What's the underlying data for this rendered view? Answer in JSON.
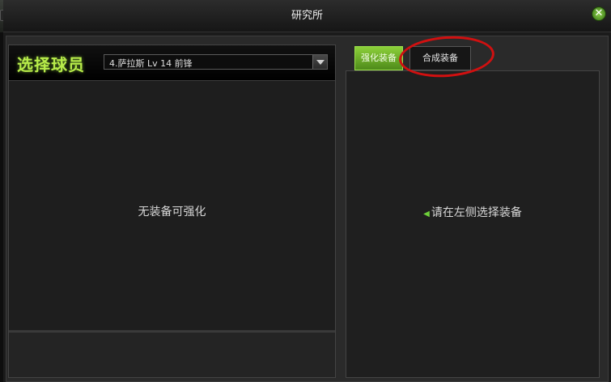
{
  "window": {
    "title": "研究所",
    "close_icon": "close-icon"
  },
  "left_panel": {
    "title": "选择球员",
    "player_select": {
      "value": "4.萨拉斯 Lv 14 前锋",
      "icon": "chevron-down-icon"
    },
    "empty_message": "无装备可强化"
  },
  "tabs": [
    {
      "label": "强化装备",
      "active": true
    },
    {
      "label": "合成装备",
      "active": false
    }
  ],
  "right_panel": {
    "hint": "请在左侧选择装备",
    "hint_icon": "left-triangle-icon"
  },
  "colors": {
    "accent_green": "#8cd03a",
    "title_green": "#b8ec4a",
    "annotation_red": "#d11010"
  }
}
